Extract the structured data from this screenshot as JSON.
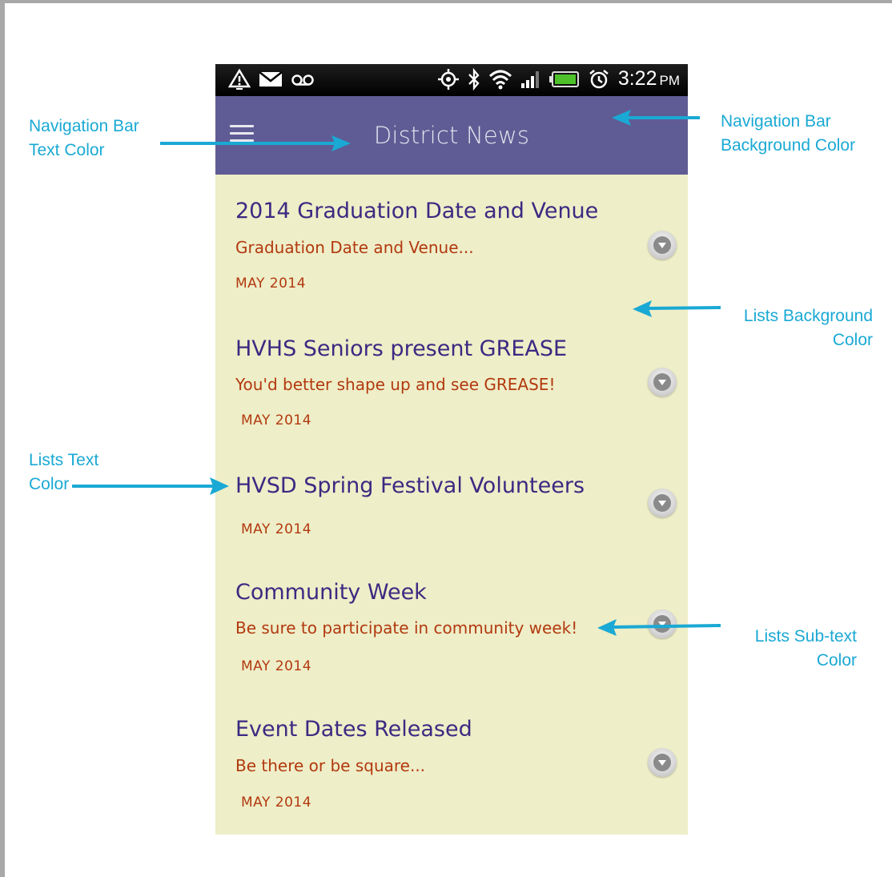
{
  "status_bar": {
    "time": "3:22",
    "ampm": "PM",
    "icons_left": [
      "alert-icon",
      "mail-icon",
      "voicemail-icon"
    ],
    "icons_right": [
      "gps-icon",
      "bluetooth-icon",
      "wifi-icon",
      "signal-icon",
      "battery-icon",
      "alarm-icon"
    ]
  },
  "navbar": {
    "title": "District News",
    "menu_icon": "hamburger-icon",
    "background_color": "#5f5c95"
  },
  "list": {
    "background_color": "#eeeec8",
    "title_color": "#3b2a82",
    "subtext_color": "#b2390f",
    "items": [
      {
        "title": "2014 Graduation Date and Venue",
        "subtitle": "Graduation Date and Venue...",
        "date": "MAY 2014"
      },
      {
        "title": "HVHS Seniors present GREASE",
        "subtitle": "You'd better shape up and see GREASE!",
        "date": "MAY 2014"
      },
      {
        "title": "HVSD Spring Festival Volunteers",
        "subtitle": "",
        "date": "MAY 2014"
      },
      {
        "title": "Community Week",
        "subtitle": "Be sure to participate in community week!",
        "date": "MAY 2014"
      },
      {
        "title": "Event Dates Released",
        "subtitle": "Be there or be square...",
        "date": "MAY 2014"
      }
    ]
  },
  "annotations": {
    "nav_text_color": [
      "Navigation Bar",
      "Text Color"
    ],
    "nav_bg_color": [
      "Navigation Bar",
      "Background Color"
    ],
    "list_bg_color": [
      "Lists Background",
      "Color"
    ],
    "list_text_color": [
      "Lists Text",
      "Color"
    ],
    "list_subtext_color": [
      "Lists Sub-text",
      "Color"
    ],
    "arrow_color": "#1aa9d4"
  }
}
